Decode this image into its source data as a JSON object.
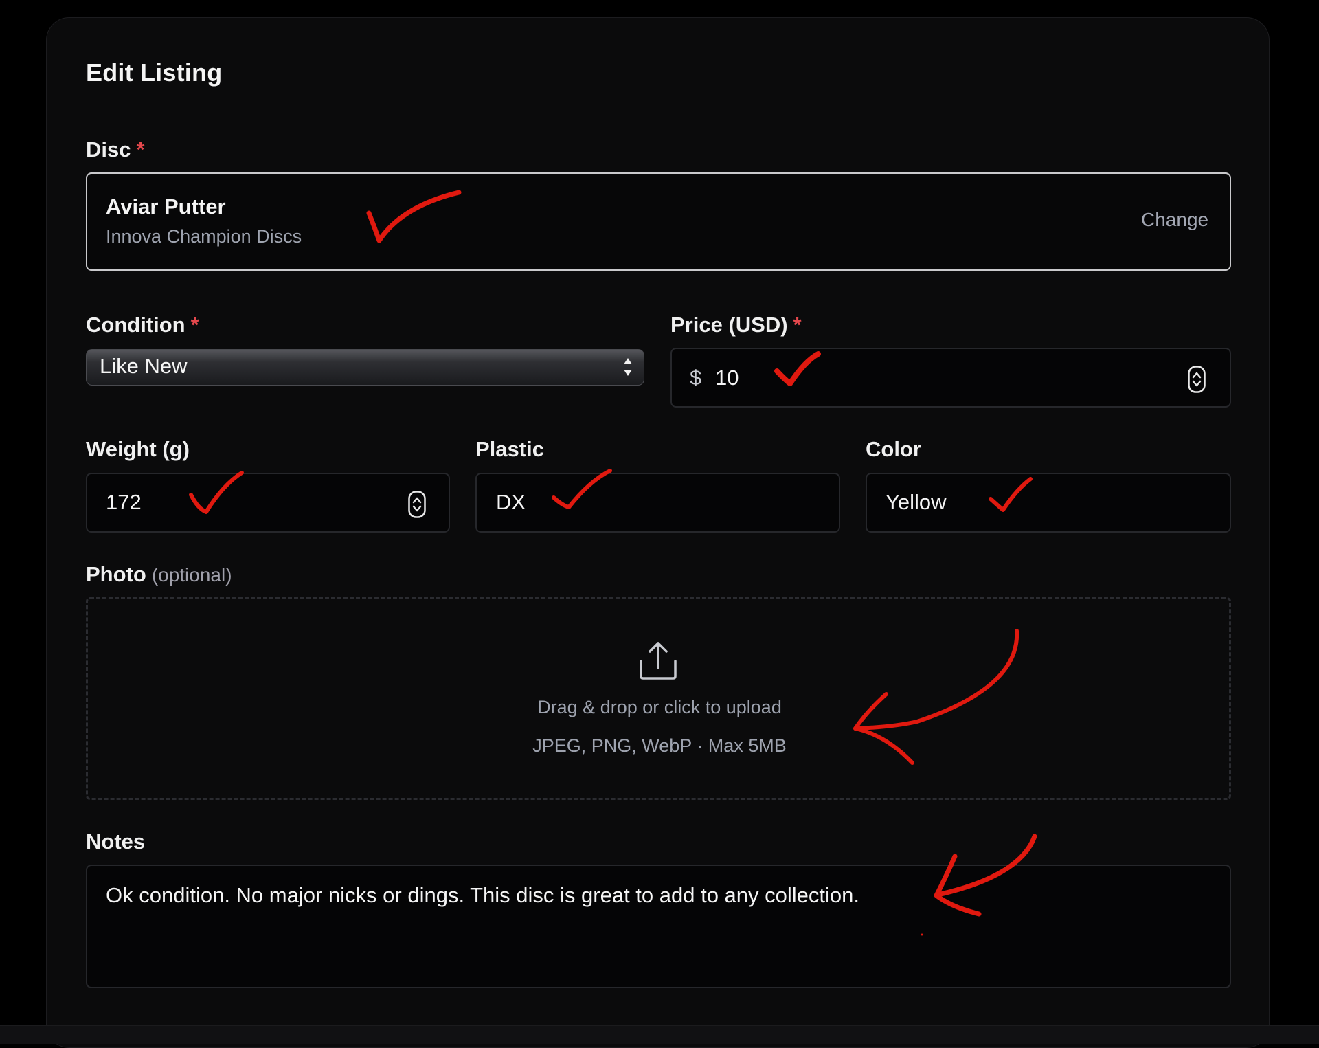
{
  "form": {
    "title": "Edit Listing",
    "required_mark": "*"
  },
  "disc": {
    "label": "Disc",
    "name": "Aviar Putter",
    "manufacturer": "Innova Champion Discs",
    "change_label": "Change"
  },
  "condition": {
    "label": "Condition",
    "value": "Like New"
  },
  "price": {
    "label": "Price (USD)",
    "currency_symbol": "$",
    "value": "10"
  },
  "weight": {
    "label": "Weight (g)",
    "value": "172"
  },
  "plastic": {
    "label": "Plastic",
    "value": "DX"
  },
  "color": {
    "label": "Color",
    "value": "Yellow"
  },
  "photo": {
    "label": "Photo",
    "optional_label": "(optional)",
    "upload_prompt": "Drag & drop or click to upload",
    "upload_hint": "JPEG, PNG, WebP · Max 5MB"
  },
  "notes": {
    "label": "Notes",
    "value": "Ok condition. No major nicks or dings. This disc is great to add to any collection."
  },
  "colors": {
    "background": "#000000",
    "card": "#0b0b0c",
    "required": "#e5484d",
    "annotation": "#e0190f",
    "muted_text": "#9fa4b0"
  },
  "icons": {
    "upload": "upload-icon",
    "select": "chevron-up-down-icon",
    "stepper": "stepper-icon",
    "annotation_check": "check-mark-icon",
    "annotation_arrow": "arrow-icon"
  }
}
